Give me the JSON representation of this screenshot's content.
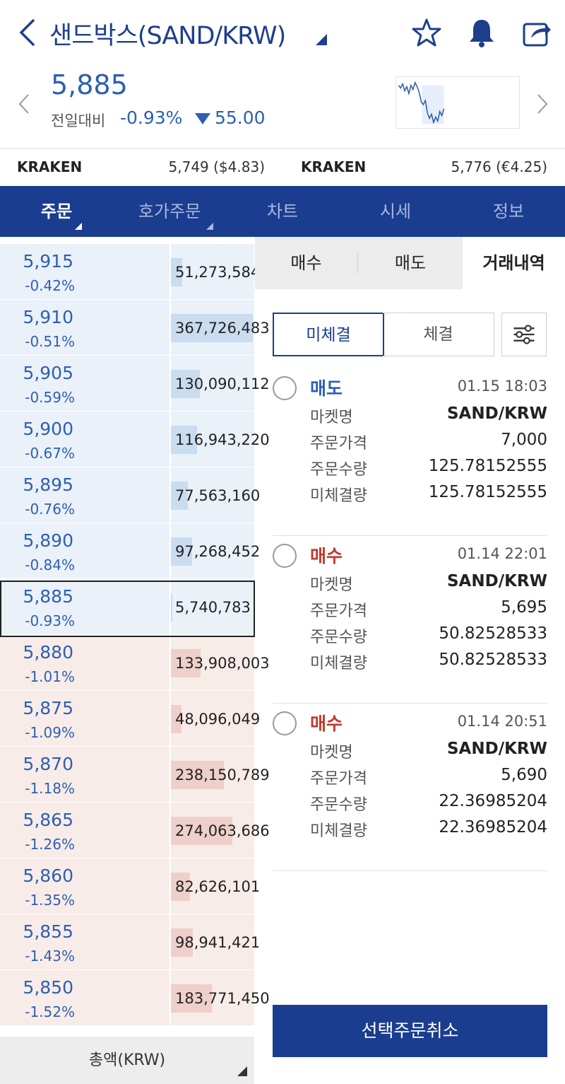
{
  "header": {
    "title": "샌드박스(SAND/KRW)",
    "price": "5,885",
    "diff_label": "전일대비",
    "diff_pct": "-0.93%",
    "diff_amt": "55.00",
    "icons": [
      "back-icon",
      "star-icon",
      "bell-icon",
      "share-icon"
    ]
  },
  "kraken": [
    {
      "name": "KRAKEN",
      "value": "5,749 ($4.83)"
    },
    {
      "name": "KRAKEN",
      "value": "5,776 (€4.25)"
    }
  ],
  "tabs": [
    "주문",
    "호가주문",
    "차트",
    "시세",
    "정보"
  ],
  "orderbook": {
    "asks": [
      {
        "price": "5,915",
        "pct": "-0.42%",
        "qty": "51,273,584",
        "fill": 0.14
      },
      {
        "price": "5,910",
        "pct": "-0.51%",
        "qty": "367,726,483",
        "fill": 1.0
      },
      {
        "price": "5,905",
        "pct": "-0.59%",
        "qty": "130,090,112",
        "fill": 0.35
      },
      {
        "price": "5,900",
        "pct": "-0.67%",
        "qty": "116,943,220",
        "fill": 0.32
      },
      {
        "price": "5,895",
        "pct": "-0.76%",
        "qty": "77,563,160",
        "fill": 0.21
      },
      {
        "price": "5,890",
        "pct": "-0.84%",
        "qty": "97,268,452",
        "fill": 0.26
      },
      {
        "price": "5,885",
        "pct": "-0.93%",
        "qty": "5,740,783",
        "fill": 0.02
      }
    ],
    "bids": [
      {
        "price": "5,880",
        "pct": "-1.01%",
        "qty": "133,908,003",
        "fill": 0.36
      },
      {
        "price": "5,875",
        "pct": "-1.09%",
        "qty": "48,096,049",
        "fill": 0.13
      },
      {
        "price": "5,870",
        "pct": "-1.18%",
        "qty": "238,150,789",
        "fill": 0.65
      },
      {
        "price": "5,865",
        "pct": "-1.26%",
        "qty": "274,063,686",
        "fill": 0.75
      },
      {
        "price": "5,860",
        "pct": "-1.35%",
        "qty": "82,626,101",
        "fill": 0.23
      },
      {
        "price": "5,855",
        "pct": "-1.43%",
        "qty": "98,941,421",
        "fill": 0.27
      },
      {
        "price": "5,850",
        "pct": "-1.52%",
        "qty": "183,771,450",
        "fill": 0.5
      }
    ],
    "total_label": "총액(KRW)"
  },
  "right": {
    "tabs": [
      "매수",
      "매도",
      "거래내역"
    ],
    "segments": [
      "미체결",
      "체결"
    ],
    "labels": [
      "마켓명",
      "주문가격",
      "주문수량",
      "미체결량"
    ],
    "orders": [
      {
        "side": "매도",
        "side_color": "#2e5fb3",
        "time": "01.15 18:03",
        "market": "SAND/KRW",
        "price": "7,000",
        "qty": "125.78152555",
        "unfilled": "125.78152555"
      },
      {
        "side": "매수",
        "side_color": "#c0392b",
        "time": "01.14 22:01",
        "market": "SAND/KRW",
        "price": "5,695",
        "qty": "50.82528533",
        "unfilled": "50.82528533"
      },
      {
        "side": "매수",
        "side_color": "#c0392b",
        "time": "01.14 20:51",
        "market": "SAND/KRW",
        "price": "5,690",
        "qty": "22.36985204",
        "unfilled": "22.36985204"
      }
    ],
    "cancel_label": "선택주문취소"
  },
  "colors": {
    "brand": "#1b3d8f",
    "down": "#2e5fb3",
    "up": "#c0392b"
  }
}
